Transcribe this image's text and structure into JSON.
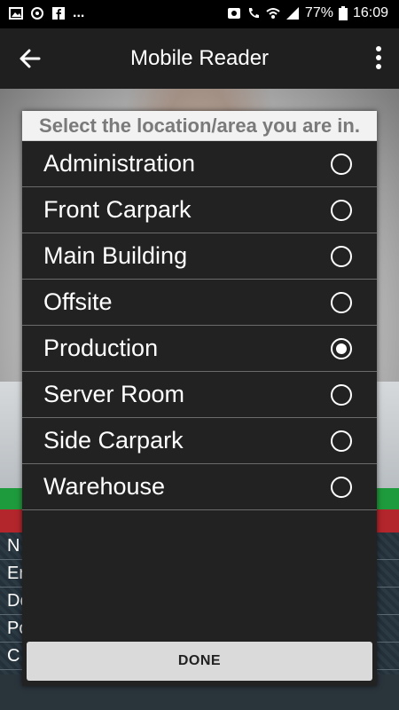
{
  "status_bar": {
    "battery_percent": "77%",
    "time": "16:09",
    "ellipsis": "...",
    "icons": [
      "gallery-icon",
      "sync-icon",
      "facebook-icon",
      "alarm-icon",
      "wifi-call-icon",
      "wifi-icon",
      "signal-icon",
      "battery-icon"
    ]
  },
  "app_bar": {
    "title": "Mobile Reader"
  },
  "background": {
    "row_letters": [
      "N",
      "Er",
      "Do",
      "Po",
      "C"
    ]
  },
  "dialog": {
    "title": "Select the location/area you are in.",
    "options": [
      {
        "label": "Administration",
        "selected": false
      },
      {
        "label": "Front Carpark",
        "selected": false
      },
      {
        "label": "Main Building",
        "selected": false
      },
      {
        "label": "Offsite",
        "selected": false
      },
      {
        "label": "Production",
        "selected": true
      },
      {
        "label": "Server Room",
        "selected": false
      },
      {
        "label": "Side Carpark",
        "selected": false
      },
      {
        "label": "Warehouse",
        "selected": false
      }
    ],
    "done_label": "DONE"
  }
}
